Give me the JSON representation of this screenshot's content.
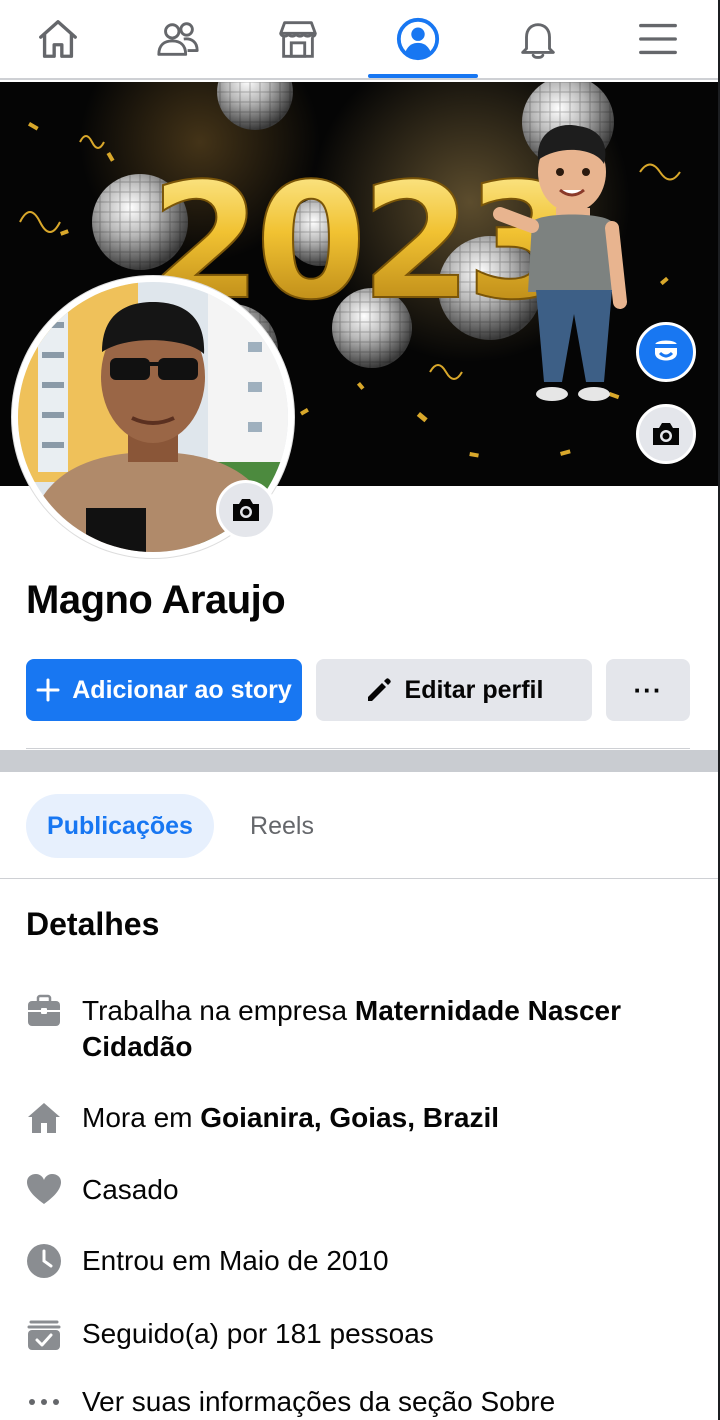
{
  "nav": {
    "items": [
      {
        "name": "home"
      },
      {
        "name": "friends"
      },
      {
        "name": "marketplace"
      },
      {
        "name": "profile",
        "active": true
      },
      {
        "name": "notifications"
      },
      {
        "name": "menu"
      }
    ]
  },
  "cover": {
    "balloon_text": "2023"
  },
  "profile": {
    "name": "Magno Araujo"
  },
  "actions": {
    "add_story": "Adicionar ao story",
    "edit_profile": "Editar perfil",
    "more": "···"
  },
  "tabs": [
    {
      "label": "Publicações",
      "active": true
    },
    {
      "label": "Reels",
      "active": false
    }
  ],
  "details": {
    "title": "Detalhes",
    "work_prefix": "Trabalha na empresa ",
    "work_bold": "Maternidade Nascer Cidadão",
    "lives_prefix": "Mora em ",
    "lives_bold": "Goianira, Goias, Brazil",
    "relationship": "Casado",
    "joined": "Entrou em Maio de 2010",
    "followers": "Seguido(a) por 181 pessoas",
    "about": "Ver suas informações da seção Sobre"
  },
  "colors": {
    "accent": "#1877f2",
    "button_gray": "#e4e6eb",
    "icon_gray": "#65676b"
  }
}
